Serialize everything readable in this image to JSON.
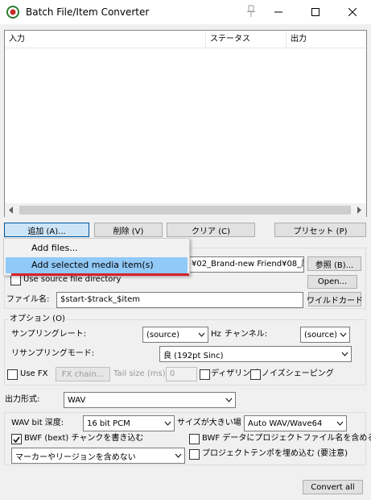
{
  "window": {
    "title": "Batch File/Item Converter",
    "minimize_icon": "minimize-icon",
    "maximize_icon": "maximize-icon",
    "close_icon": "close-icon"
  },
  "list": {
    "columns": [
      "入力",
      "ステータス",
      "出力"
    ]
  },
  "buttons": {
    "add": "追加 (A)...",
    "remove": "削除 (V)",
    "clear": "クリア (C)",
    "preset": "プリセット (P)"
  },
  "add_menu": {
    "items": [
      "Add files...",
      "Add selected media item(s)"
    ]
  },
  "output": {
    "path_value": "¥02_Brand-new Friend¥08_風(",
    "browse_label": "参照 (B)...",
    "use_source_label": "Use source file directory",
    "open_label": "Open...",
    "filename_label": "ファイル名:",
    "filename_value": "$start-$track_$item",
    "wildcard_label": "ワイルドカード"
  },
  "options": {
    "group_title": "オプション (O)",
    "sample_rate_label": "サンプリングレート:",
    "sample_rate_value": "(source)",
    "hz_label": "Hz",
    "channels_label": "チャンネル:",
    "channels_value": "(source)",
    "resample_label": "リサンプリングモード:",
    "resample_value": "良 (192pt Sinc)",
    "use_fx_label": "Use FX",
    "fx_chain_label": "FX chain...",
    "tail_label": "Tail size (ms):",
    "tail_value": "0",
    "dither_label": "ディザリング",
    "noise_shaping_label": "ノイズシェーピング"
  },
  "format": {
    "label": "出力形式:",
    "value": "WAV",
    "bit_depth_label": "WAV bit 深度:",
    "bit_depth_value": "16 bit PCM",
    "large_files_label": "サイズが大きい場",
    "large_files_value": "Auto WAV/Wave64",
    "bext_label": "BWF (bext) チャンクを書き込む",
    "bwf_project_label": "BWF データにプロジェクトファイル名を含める",
    "markers_value": "マーカーやリージョンを含めない",
    "tempo_label": "プロジェクトテンポを埋め込む (要注意)"
  },
  "convert_all_label": "Convert all",
  "colors": {
    "menu_highlight": "#91c9f7",
    "annotation_red": "#d81f2a",
    "pressed_button": "#cce4f7"
  }
}
